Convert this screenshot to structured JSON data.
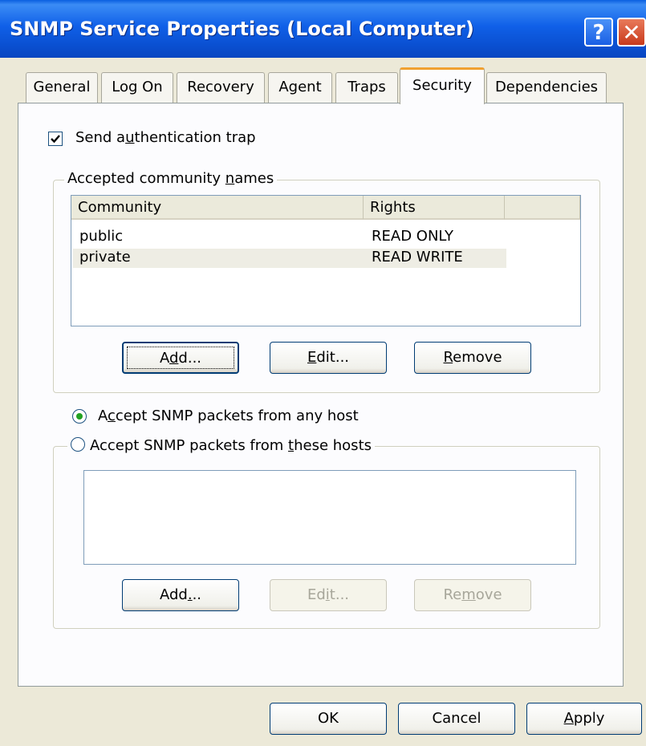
{
  "window": {
    "title": "SNMP Service Properties (Local Computer)",
    "help_glyph": "?",
    "close_glyph": "✕"
  },
  "tabs": [
    "General",
    "Log On",
    "Recovery",
    "Agent",
    "Traps",
    "Security",
    "Dependencies"
  ],
  "active_tab": "Security",
  "security": {
    "send_auth_trap": {
      "pre": "Send a",
      "accel": "u",
      "post": "thentication trap",
      "checked": true
    },
    "community_group": {
      "pre": "Accepted community ",
      "accel": "n",
      "post": "ames"
    },
    "columns": [
      "Community",
      "Rights"
    ],
    "communities": [
      {
        "name": "public",
        "rights": "READ ONLY"
      },
      {
        "name": "private",
        "rights": "READ WRITE"
      }
    ],
    "community_buttons": {
      "add": {
        "pre": "A",
        "accel": "d",
        "post": "d..."
      },
      "edit": {
        "pre": "",
        "accel": "E",
        "post": "dit..."
      },
      "remove": {
        "pre": "",
        "accel": "R",
        "post": "emove"
      }
    },
    "any_host_radio": {
      "pre": "A",
      "accel": "c",
      "post": "cept SNMP packets from any host",
      "selected": true
    },
    "these_hosts_radio": {
      "pre": "Accept SNMP packets from ",
      "accel": "t",
      "post": "hese hosts",
      "selected": false
    },
    "host_buttons": {
      "add": {
        "pre": "Add",
        "accel": ".",
        "post": ".."
      },
      "edit": {
        "pre": "Ed",
        "accel": "i",
        "post": "t..."
      },
      "remove": {
        "pre": "Re",
        "accel": "m",
        "post": "ove"
      }
    }
  },
  "footer_buttons": {
    "ok": "OK",
    "cancel": "Cancel",
    "apply": {
      "pre": "",
      "accel": "A",
      "post": "pply"
    }
  }
}
